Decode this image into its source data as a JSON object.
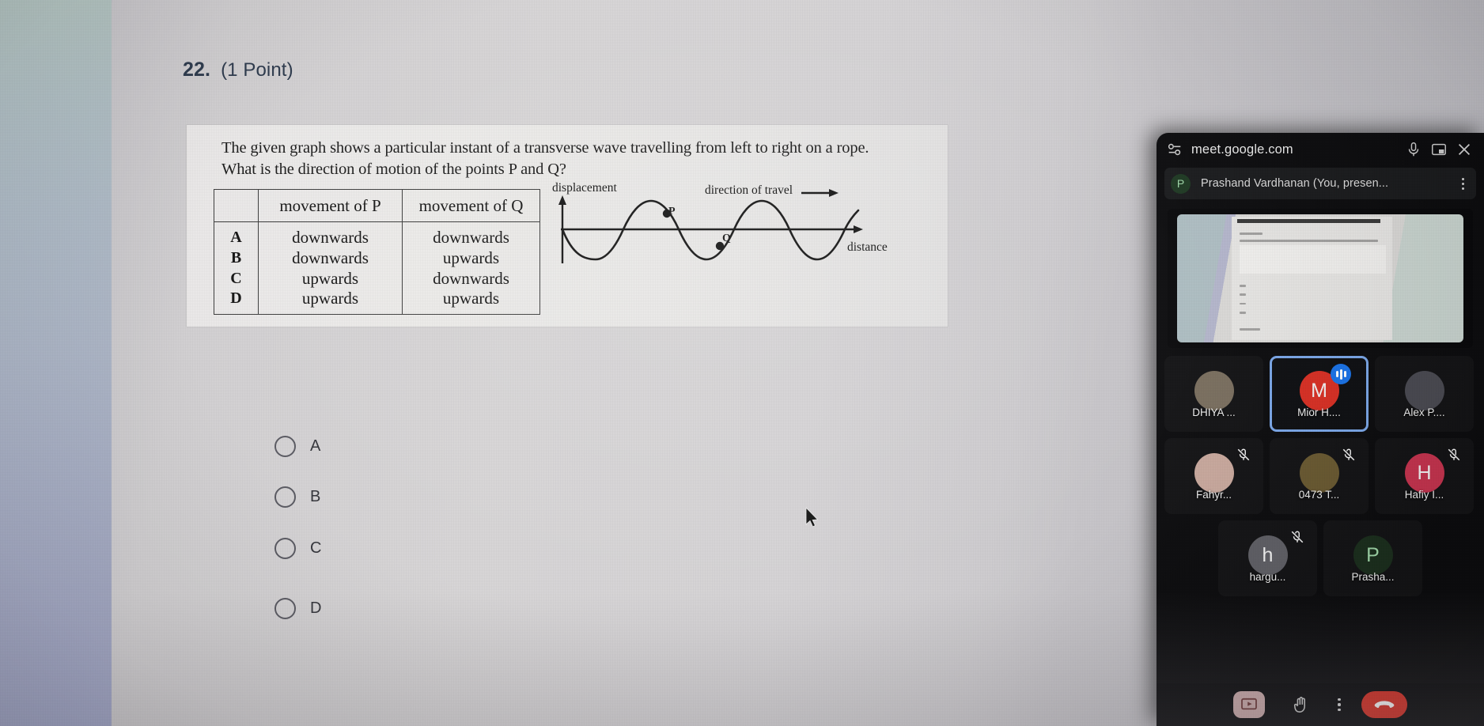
{
  "quiz": {
    "question_number": "22.",
    "points_label": "(1 Point)",
    "question_text_line1": "The given graph shows a particular instant of a transverse wave travelling from left to right on a rope.",
    "question_text_line2": "What is the direction of motion of the points P and Q?",
    "table": {
      "blank_header": "",
      "headers": [
        "movement of P",
        "movement of Q"
      ],
      "rows": [
        {
          "key": "A",
          "p": "downwards",
          "q": "downwards"
        },
        {
          "key": "B",
          "p": "downwards",
          "q": "upwards"
        },
        {
          "key": "C",
          "p": "upwards",
          "q": "downwards"
        },
        {
          "key": "D",
          "p": "upwards",
          "q": "upwards"
        }
      ]
    },
    "diagram": {
      "y_axis_label": "displacement",
      "x_axis_label": "distance",
      "travel_label": "direction of travel",
      "point_p_label": "P",
      "point_q_label": "Q"
    },
    "options": [
      {
        "label": "A",
        "selected": false
      },
      {
        "label": "B",
        "selected": false
      },
      {
        "label": "C",
        "selected": false
      },
      {
        "label": "D",
        "selected": false
      }
    ]
  },
  "meet": {
    "url": "meet.google.com",
    "presenter": {
      "initial": "P",
      "name": "Prashand Vardhanan (You, presen..."
    },
    "participants": [
      {
        "name": "DHIYA ...",
        "initial": "",
        "avatar_color": "#7a6f5f",
        "muted": false,
        "speaking": false,
        "has_photo": true
      },
      {
        "name": "Mior H....",
        "initial": "M",
        "avatar_color": "#d93025",
        "muted": false,
        "speaking": true,
        "has_photo": false
      },
      {
        "name": "Alex P....",
        "initial": "",
        "avatar_color": "#4a4a52",
        "muted": false,
        "speaking": false,
        "has_photo": true
      },
      {
        "name": "Fahyr...",
        "initial": "",
        "avatar_color": "#c9a99e",
        "muted": true,
        "speaking": false,
        "has_photo": true
      },
      {
        "name": "0473 T...",
        "initial": "",
        "avatar_color": "#6a5a32",
        "muted": true,
        "speaking": false,
        "has_photo": true
      },
      {
        "name": "Hafiy I...",
        "initial": "H",
        "avatar_color": "#c5344f",
        "muted": true,
        "speaking": false,
        "has_photo": false
      },
      {
        "name": "hargu...",
        "initial": "h",
        "avatar_color": "#606066",
        "muted": true,
        "speaking": false,
        "has_photo": false
      },
      {
        "name": "Prasha...",
        "initial": "P",
        "avatar_color": "#1c2f1e",
        "muted": false,
        "speaking": false,
        "has_photo": false
      }
    ],
    "icons": {
      "permissions": "permissions-icon",
      "mic": "microphone-icon",
      "pip": "picture-in-picture-icon",
      "close": "close-icon",
      "present": "present-screen-icon",
      "raise_hand": "raise-hand-icon",
      "more": "more-options-icon",
      "end_call": "end-call-icon"
    },
    "colors": {
      "accent_blue": "#1a73e8",
      "speaking_border": "#7ba7e8",
      "end_call_red": "#d93025",
      "panel_bg": "#0d0d0f"
    }
  }
}
